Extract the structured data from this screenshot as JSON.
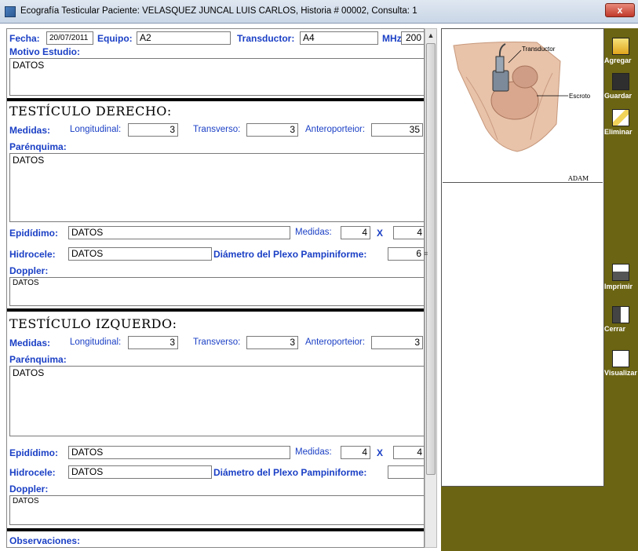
{
  "window": {
    "title": "Ecografía Testicular  Paciente: VELASQUEZ JUNCAL LUIS CARLOS, Historia # 00002, Consulta: 1",
    "close_label": "x"
  },
  "header": {
    "fecha_label": "Fecha:",
    "fecha_value": "20/07/2011",
    "equipo_label": "Equipo:",
    "equipo_value": "A2",
    "transductor_label": "Transductor:",
    "transductor_value": "A4",
    "mhz_label": "MHz:",
    "mhz_value": "200",
    "motivo_label": "Motivo Estudio:",
    "motivo_value": "DATOS"
  },
  "derecho": {
    "heading": "TESTÍCULO DERECHO:",
    "medidas_label": "Medidas:",
    "longitudinal_label": "Longitudinal:",
    "longitudinal_value": "3",
    "transverso_label": "Transverso:",
    "transverso_value": "3",
    "antero_label": "Anteroporteior:",
    "antero_value": "35",
    "parenquima_label": "Parénquima:",
    "parenquima_value": "DATOS",
    "epididimo_label": "Epidídimo:",
    "epididimo_value": "DATOS",
    "medidas2_label": "Medidas:",
    "medidas2_a": "4",
    "x_label": "X",
    "medidas2_b": "4",
    "hidrocele_label": "Hidrocele:",
    "hidrocele_value": "DATOS",
    "plexo_label": "Diámetro del Plexo Pampiniforme:",
    "plexo_value": "6",
    "doppler_label": "Doppler:",
    "doppler_value": "DATOS"
  },
  "izquierdo": {
    "heading": "TESTÍCULO IZQUERDO:",
    "medidas_label": "Medidas:",
    "longitudinal_label": "Longitudinal:",
    "longitudinal_value": "3",
    "transverso_label": "Transverso:",
    "transverso_value": "3",
    "antero_label": "Anteroporteior:",
    "antero_value": "3",
    "parenquima_label": "Parénquima:",
    "parenquima_value": "DATOS",
    "epididimo_label": "Epidídimo:",
    "epididimo_value": "DATOS",
    "medidas2_label": "Medidas:",
    "medidas2_a": "4",
    "x_label": "X",
    "medidas2_b": "4",
    "hidrocele_label": "Hidrocele:",
    "hidrocele_value": "DATOS",
    "plexo_label": "Diámetro del Plexo Pampiniforme:",
    "plexo_value": "",
    "doppler_label": "Doppler:",
    "doppler_value": "DATOS"
  },
  "observaciones_label": "Observaciones:",
  "illustration": {
    "transductor_label": "Transductor",
    "escroto_label": "Escroto",
    "credit": "ADAM"
  },
  "toolbar": {
    "agregar": "Agregar",
    "guardar": "Guardar",
    "eliminar": "Eliminar",
    "imprimir": "Imprimir",
    "cerrar": "Cerrar",
    "visualizar": "Visualizar"
  }
}
